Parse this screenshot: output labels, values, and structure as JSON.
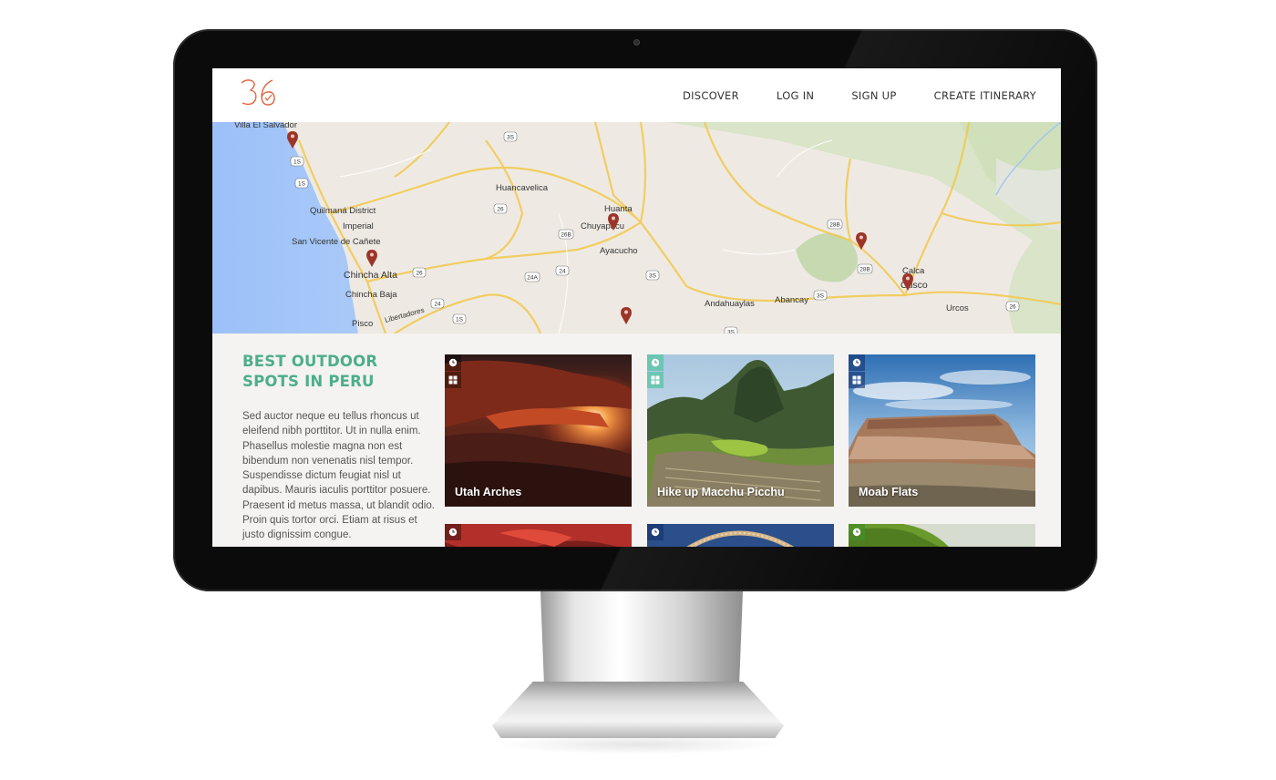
{
  "header": {
    "logo_text": "36",
    "nav": [
      "DISCOVER",
      "LOG IN",
      "SIGN UP",
      "CREATE ITINERARY"
    ]
  },
  "map": {
    "places": [
      {
        "name": "Villa El Salvador"
      },
      {
        "name": "Huancavelica"
      },
      {
        "name": "Quilmaná District"
      },
      {
        "name": "Imperial"
      },
      {
        "name": "San Vicente de Cañete"
      },
      {
        "name": "Huanta"
      },
      {
        "name": "Chuyapacu"
      },
      {
        "name": "Ayacucho"
      },
      {
        "name": "Chincha Alta"
      },
      {
        "name": "Chincha Baja"
      },
      {
        "name": "Pisco"
      },
      {
        "name": "Libertadores"
      },
      {
        "name": "Andahuaylas"
      },
      {
        "name": "Abancay"
      },
      {
        "name": "Calca"
      },
      {
        "name": "Cusco"
      },
      {
        "name": "Urcos"
      }
    ],
    "shields": [
      "3S",
      "1S",
      "26",
      "26B",
      "24A",
      "24",
      "3S",
      "28B",
      "3S",
      "26",
      "24",
      "1S",
      "3S",
      "26",
      "1S",
      "28B"
    ]
  },
  "intro": {
    "title": "BEST OUTDOOR SPOTS IN PERU",
    "description": "Sed auctor neque eu tellus rhoncus ut eleifend nibh porttitor. Ut in nulla enim. Phasellus molestie magna non est bibendum non venenatis nisl tempor. Suspendisse dictum feugiat nisl ut dapibus. Mauris iaculis porttitor posuere. Praesent id metus massa, ut blandit odio. Proin quis tortor orci. Etiam at risus et justo dignissim congue."
  },
  "cards": [
    {
      "label": "Utah Arches"
    },
    {
      "label": "Hike up Macchu Picchu"
    },
    {
      "label": "Moab Flats"
    },
    {
      "label": ""
    },
    {
      "label": ""
    },
    {
      "label": ""
    }
  ],
  "colors": {
    "accent_teal": "#4cae8b",
    "logo_orange": "#e2633d",
    "pin_red": "#9d3428"
  }
}
